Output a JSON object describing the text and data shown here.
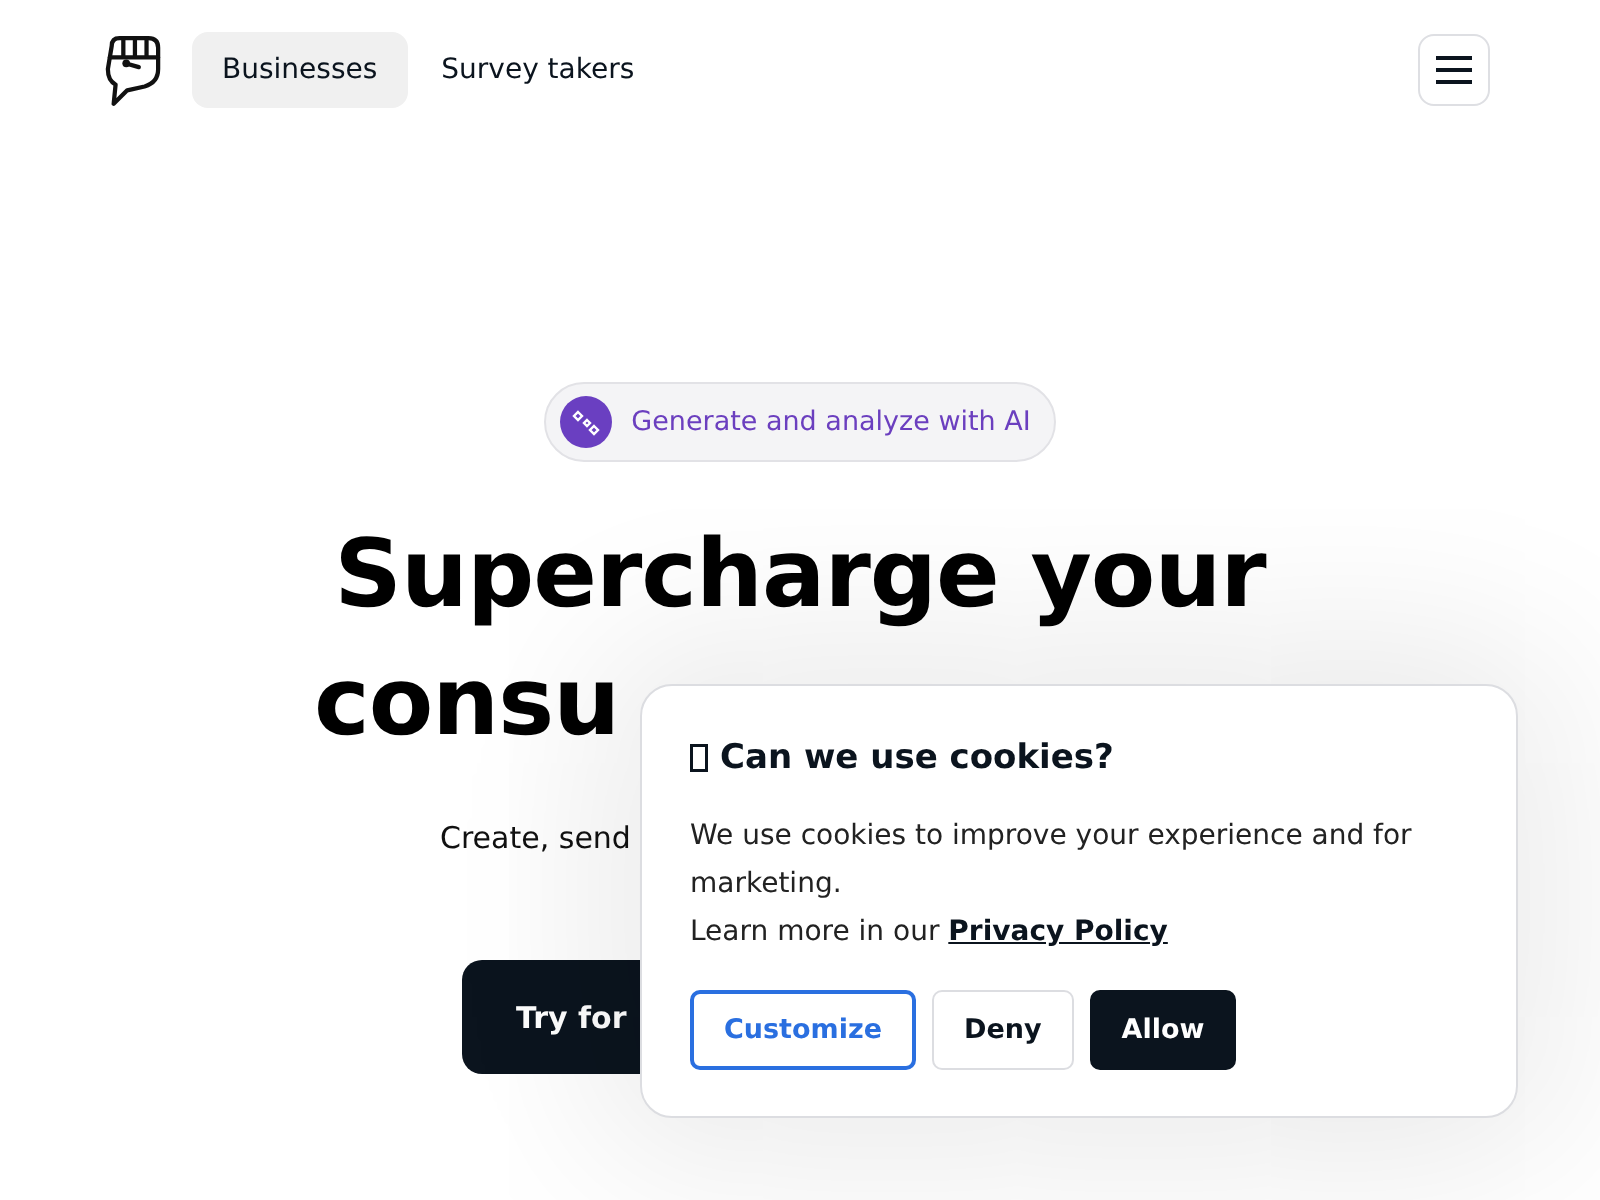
{
  "nav": {
    "tabs": [
      {
        "label": "Businesses",
        "selected": true
      },
      {
        "label": "Survey takers",
        "selected": false
      }
    ]
  },
  "hero": {
    "badge": "Generate and analyze with AI",
    "heading_lines": [
      "Supercharge your",
      "consu"
    ],
    "subtitle": "Create, send",
    "cta": "Try for"
  },
  "cookie_dialog": {
    "title": "Can we use cookies?",
    "body": "We use cookies to improve your experience and for marketing.",
    "learn_more": "Learn more in our",
    "link": "Privacy Policy",
    "buttons": [
      {
        "label": "Customize",
        "kind": "outline"
      },
      {
        "label": "Deny",
        "kind": "plain"
      },
      {
        "label": "Allow",
        "kind": "primary"
      }
    ]
  }
}
